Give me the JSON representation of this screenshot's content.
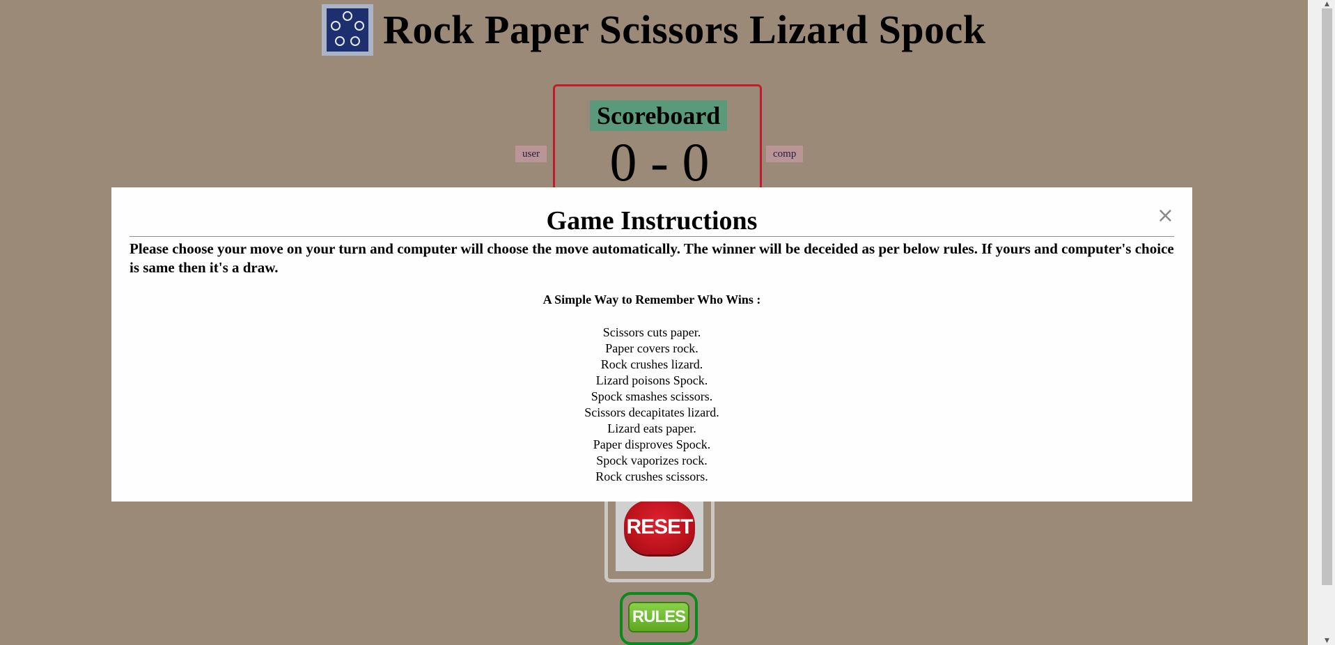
{
  "header": {
    "title": "Rock Paper Scissors Lizard Spock",
    "logo_icon": "rpsls-logo-icon"
  },
  "scoreboard": {
    "title": "Scoreboard",
    "score": "0 - 0",
    "user_label": "user",
    "comp_label": "comp"
  },
  "controls": {
    "reset_label": "RESET",
    "rules_label": "RULES"
  },
  "modal": {
    "title": "Game Instructions",
    "close_symbol": "×",
    "description": "Please choose your move on your turn and computer will choose the move automatically. The winner will be deceided as per below rules. If yours and computer's choice is same then it's a draw.",
    "subheading": "A Simple Way to Remember Who Wins :",
    "rules": [
      "Scissors cuts paper.",
      "Paper covers rock.",
      "Rock crushes lizard.",
      "Lizard poisons Spock.",
      "Spock smashes scissors.",
      "Scissors decapitates lizard.",
      "Lizard eats paper.",
      "Paper disproves Spock.",
      "Spock vaporizes rock.",
      "Rock crushes scissors."
    ]
  },
  "colors": {
    "page_background": "#9c8a78",
    "scoreboard_border": "#c01c2d",
    "scoreboard_title_bg": "#5a9a7b",
    "reset_red": "#d01a24",
    "rules_green": "#6fba2c"
  }
}
